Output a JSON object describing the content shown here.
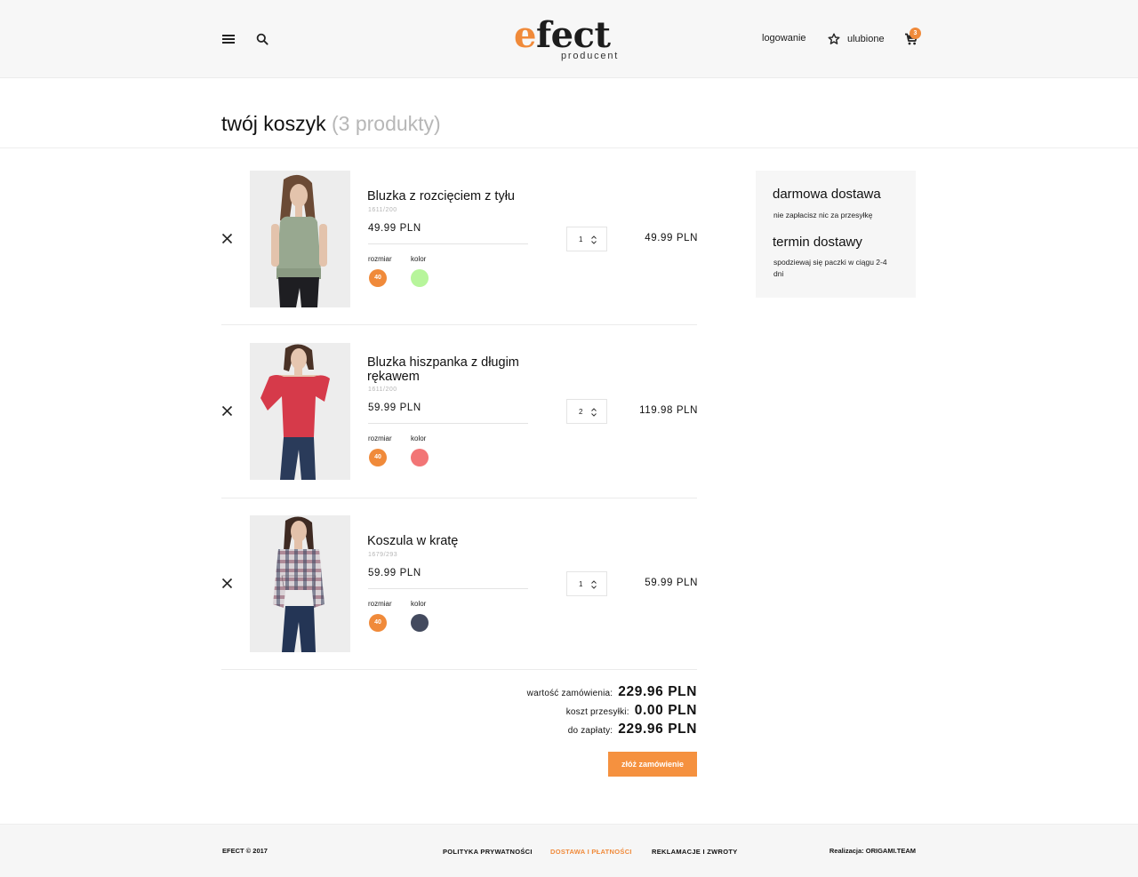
{
  "header": {
    "logo_main": "fect",
    "logo_e": "e",
    "logo_sub": "producent",
    "login": "logowanie",
    "favorites": "ulubione",
    "cart_count": "3",
    "icons": [
      "menu-icon",
      "search-icon",
      "star-icon",
      "cart-icon"
    ]
  },
  "page": {
    "title": "twój koszyk",
    "count": "(3 produkty)"
  },
  "items": [
    {
      "name": "Bluzka z rozcięciem z tyłu",
      "sku": "1611/200",
      "price": "49.99 PLN",
      "size_label": "rozmiar",
      "size": "40",
      "color_label": "kolor",
      "color": "#b7f59b",
      "qty": "1",
      "total": "49.99 PLN"
    },
    {
      "name": "Bluzka hiszpanka z długim rękawem",
      "sku": "1611/200",
      "price": "59.99 PLN",
      "size_label": "rozmiar",
      "size": "40",
      "color_label": "kolor",
      "color": "#f27576",
      "qty": "2",
      "total": "119.98 PLN"
    },
    {
      "name": "Koszula w kratę",
      "sku": "1679/293",
      "price": "59.99 PLN",
      "size_label": "rozmiar",
      "size": "40",
      "color_label": "kolor",
      "color": "#434a5e",
      "qty": "1",
      "total": "59.99 PLN"
    }
  ],
  "summary": {
    "order_value_label": "wartość zamówienia:",
    "order_value": "229.96 PLN",
    "shipping_label": "koszt przesyłki:",
    "shipping": "0.00 PLN",
    "to_pay_label": "do zapłaty:",
    "to_pay": "229.96 PLN",
    "button": "złóż zamówienie"
  },
  "sidebar": {
    "free_delivery_title": "darmowa dostawa",
    "free_delivery_text": "nie zapłacisz nic za przesyłkę",
    "delivery_time_title": "termin dostawy",
    "delivery_time_text": "spodziewaj się paczki w ciągu 2-4 dni"
  },
  "footer": {
    "copyright": "EFECT © 2017",
    "link_privacy": "POLITYKA PRYWATNOŚCI",
    "link_delivery": "DOSTAWA I PŁATNOŚCI",
    "link_returns": "REKLAMACJE I ZWROTY",
    "credit": "Realizacja: ORIGAMI.TEAM"
  },
  "colors": {
    "accent": "#f08a3a",
    "button": "#f5913f"
  }
}
